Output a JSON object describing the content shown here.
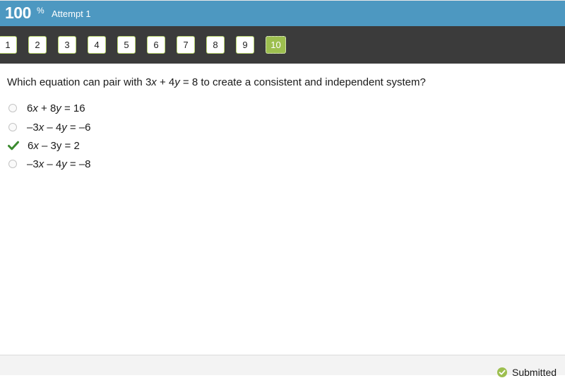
{
  "header": {
    "score": "100",
    "score_unit": "%",
    "attempt": "Attempt 1"
  },
  "nav": {
    "questions": [
      "1",
      "2",
      "3",
      "4",
      "5",
      "6",
      "7",
      "8",
      "9",
      "10"
    ],
    "active": "10"
  },
  "question": {
    "text_pre": "Which equation can pair with 3",
    "var1": "x",
    "text_mid": " + 4",
    "var2": "y",
    "text_post": " = 8 to create a consistent and independent system?"
  },
  "options": [
    {
      "parts": [
        "6",
        "x",
        " + 8",
        "y",
        " = 16"
      ],
      "state": "unselected"
    },
    {
      "parts": [
        "–3",
        "x",
        " – 4",
        "y",
        " = –6"
      ],
      "state": "unselected"
    },
    {
      "parts": [
        "6",
        "x",
        " – 3y = 2",
        "",
        ""
      ],
      "state": "correct"
    },
    {
      "parts": [
        "–3",
        "x",
        " – 4",
        "y",
        " = –8"
      ],
      "state": "unselected"
    }
  ],
  "footer": {
    "status": "Submitted"
  },
  "colors": {
    "header_bg": "#4d98c1",
    "nav_bg": "#3b3b3b",
    "accent_green": "#9dbf4f",
    "check_green": "#3a8a2e"
  },
  "icons": {
    "correct": "checkmark-icon",
    "submitted": "check-circle-icon"
  }
}
